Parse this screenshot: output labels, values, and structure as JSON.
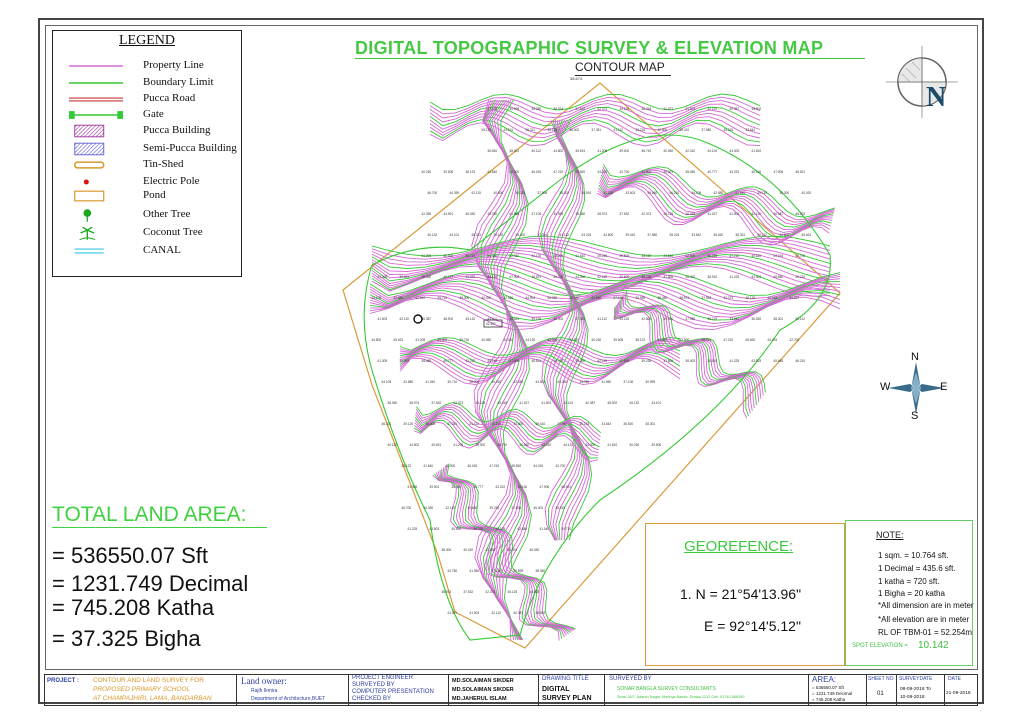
{
  "legend": {
    "title": "LEGEND",
    "items": [
      {
        "label": "Property  Line",
        "kind": "line",
        "color": "#d36ad3"
      },
      {
        "label": "Boundary Limit",
        "kind": "line",
        "color": "#35c935"
      },
      {
        "label": "Pucca Road",
        "kind": "double",
        "color": "#c73636"
      },
      {
        "label": "Gate",
        "kind": "gate",
        "color": "#35c935"
      },
      {
        "label": "Pucca Building",
        "kind": "hatch",
        "color": "#a23ea2"
      },
      {
        "label": "Semi-Pucca Building",
        "kind": "hatch",
        "color": "#6a6ad3"
      },
      {
        "label": "Tin-Shed",
        "kind": "tin",
        "color": "#d9962a"
      },
      {
        "label": "Electric  Pole",
        "kind": "dot",
        "color": "#d11"
      },
      {
        "label": "Pond",
        "kind": "pond",
        "color": "#d9962a"
      },
      {
        "label": "Other Tree",
        "kind": "tree",
        "color": "#1aa91a"
      },
      {
        "label": "Coconut Tree",
        "kind": "palm",
        "color": "#1aa91a"
      },
      {
        "label": "CANAL",
        "kind": "canal",
        "color": "#39c6dd"
      }
    ]
  },
  "title": {
    "main": "DIGITAL TOPOGRAPHIC SURVEY & ELEVATION MAP",
    "sub": "CONTOUR MAP"
  },
  "north_arrow": {
    "letter": "N"
  },
  "compass": {
    "n": "N",
    "s": "S",
    "e": "E",
    "w": "W"
  },
  "map": {
    "top_label": "38.674",
    "spot_heights": [
      "37.106",
      "30.999",
      "38.360",
      "38.974",
      "37.532",
      "42.373",
      "45.125",
      "46.318",
      "41.027",
      "41.503",
      "42.110",
      "40.387",
      "48.902",
      "45.132",
      "43.101",
      "46.321",
      "39.120",
      "36.402",
      "37.351",
      "41.112",
      "43.215",
      "42.800",
      "39.410",
      "37.980",
      "35.215",
      "33.642",
      "36.520",
      "38.301",
      "40.112",
      "44.802",
      "45.631",
      "41.205",
      "39.002",
      "38.710",
      "40.550",
      "42.310",
      "44.120",
      "43.300",
      "41.810",
      "40.230",
      "39.505",
      "38.122",
      "41.640",
      "42.900",
      "46.015",
      "47.210",
      "45.820",
      "44.015",
      "42.700",
      "41.305",
      "39.901",
      "38.450",
      "40.777",
      "43.222",
      "45.118",
      "47.906",
      "48.521",
      "46.700",
      "44.390",
      "42.115",
      "40.600",
      "39.235",
      "37.805",
      "36.402",
      "38.910",
      "41.225",
      "43.503",
      "45.660",
      "46.210",
      "44.105",
      "42.880",
      "41.040",
      "39.710",
      "38.300",
      "40.020",
      "42.350",
      "44.901",
      "45.330",
      "43.780",
      "41.960"
    ],
    "crosshair_label": "42.407"
  },
  "total": {
    "title": "TOTAL LAND AREA:",
    "lines": [
      "= 536550.07 Sft",
      "= 1231.749  Decimal",
      "= 745.208 Katha",
      "= 37.325 Bigha"
    ]
  },
  "georef": {
    "title": "GEOREFENCE:",
    "n": "1. N = 21°54'13.96\"",
    "e": "E = 92°14'5.12\""
  },
  "note": {
    "title": "NOTE:",
    "lines": [
      "1  sqm.     = 10.764 sft.",
      "1  Decimal = 435.6 sft.",
      "1  katha    = 720 sft.",
      "1  Bigha    = 20 katha",
      "*All dimension are in meter",
      "*All elevation are in meter",
      "RL OF TBM-01 = 52.254m"
    ],
    "spot_label": "SPOT ELEVATION =",
    "spot_value": "10.142"
  },
  "title_block": {
    "project_label": "PROJECT :",
    "project_lines": [
      "CONTOUR AND LAND SURVEY FOR",
      "PROPOSED PRIMARY SCHOOL",
      "AT CHAMPAJHIRI, LAMA, BANDARBAN"
    ],
    "owner_label": "Land owner:",
    "owner_lines": [
      "Rajih Ikmira",
      "Department of Architecture,BUET"
    ],
    "roles": [
      "PROJECT ENGINEER",
      "SURVEYED BY",
      "COMPUTER PRESENTATION",
      "CHECKED BY"
    ],
    "names": [
      "MD.SOLAIMAN  SIKDER",
      "MD.SOLAIMAN  SIKDER",
      "MD.JAHERUL  ISLAM"
    ],
    "drawing_title_label": "DRAWING TITLE",
    "drawing_title": [
      "DIGITAL",
      "SURVEY  PLAN"
    ],
    "surveyed_by_label": "SURVEYED BY",
    "surveyor_lines": [
      "SONAR BANGLA SURVEY CONSULTANTS",
      "Store-26/7, Adarsh Nagar, Madhya Badda, Dhaka-1212 Cell: 01740-566390"
    ],
    "area_label": "AREA:",
    "area_lines": [
      "= 536550.07 Sft",
      "= 1231.749  Decimal",
      "= 745.208 Katha"
    ],
    "sheet_label": "SHEET NO",
    "sheet_value": "01",
    "surveydate_label": "SURVEYDATE",
    "surveydate_lines": [
      "08-09-2018 To",
      "10-09-2018"
    ],
    "date_label": "DATE",
    "date_value": "21-09-2018"
  }
}
